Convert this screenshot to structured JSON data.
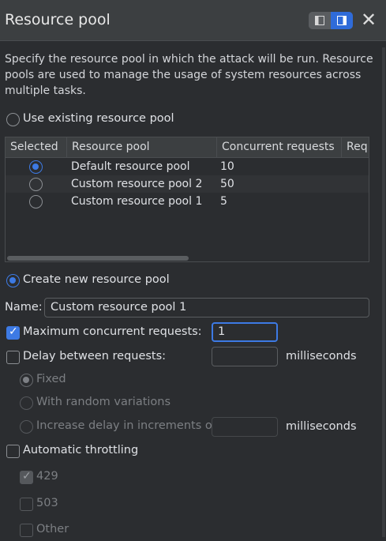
{
  "header": {
    "title": "Resource pool",
    "close_glyph": "✕",
    "layout_icon": "split-view-icon"
  },
  "description": "Specify the resource pool in which the attack will be run. Resource pools are used to manage the usage of system resources across multiple tasks.",
  "use_existing": {
    "label": "Use existing resource pool",
    "selected": false
  },
  "table": {
    "columns": [
      "Selected",
      "Resource pool",
      "Concurrent requests",
      "Req"
    ],
    "rows": [
      {
        "selected": true,
        "name": "Default resource pool",
        "concurrent": "10"
      },
      {
        "selected": false,
        "name": "Custom resource pool 2",
        "concurrent": "50"
      },
      {
        "selected": false,
        "name": "Custom resource pool 1",
        "concurrent": "5"
      }
    ]
  },
  "create_new": {
    "label": "Create new resource pool",
    "selected": true
  },
  "name_field": {
    "label": "Name:",
    "value": "Custom resource pool 1"
  },
  "max_concurrent": {
    "label": "Maximum concurrent requests:",
    "checked": true,
    "value": "1"
  },
  "delay": {
    "label": "Delay between requests:",
    "checked": false,
    "value": "",
    "unit": "milliseconds",
    "options": [
      {
        "label": "Fixed",
        "selected": true
      },
      {
        "label": "With random variations",
        "selected": false
      },
      {
        "label": "Increase delay in increments of",
        "selected": false,
        "value": "",
        "unit": "milliseconds"
      }
    ]
  },
  "throttling": {
    "label": "Automatic throttling",
    "checked": false,
    "codes": [
      {
        "label": "429",
        "checked": true
      },
      {
        "label": "503",
        "checked": false
      },
      {
        "label": "Other",
        "checked": false
      }
    ]
  },
  "colors": {
    "accent": "#3d7ae4",
    "background": "#2b2d30",
    "header": "#3c3f41"
  }
}
